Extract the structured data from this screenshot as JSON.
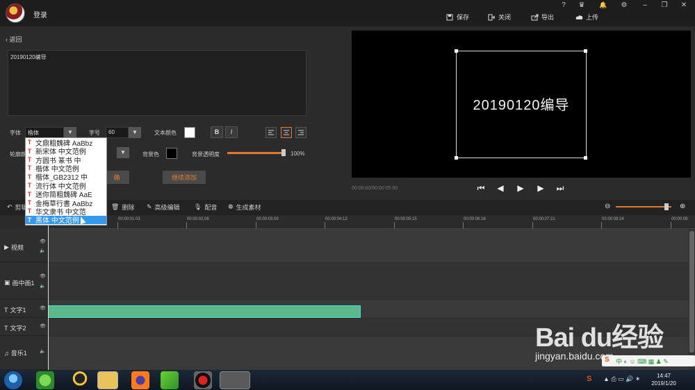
{
  "header": {
    "login_label": "登录",
    "actions": [
      {
        "label": "保存",
        "icon": "save-icon"
      },
      {
        "label": "关闭",
        "icon": "exit-icon"
      },
      {
        "label": "导出",
        "icon": "export-icon"
      },
      {
        "label": "上传",
        "icon": "upload-icon"
      }
    ],
    "window_controls": [
      "?",
      "♛",
      "🔔",
      "⚙",
      "–",
      "❐",
      "✕"
    ]
  },
  "editor": {
    "back_label": "返回",
    "text_value": "20190120编导",
    "font_label": "字体",
    "font_value": "楷体",
    "size_label": "字号",
    "size_value": "60",
    "text_color_label": "文本颜色",
    "bold_label": "B",
    "italic_label": "I",
    "outline_label": "轮廓颜",
    "bg_color_label": "背景色",
    "bg_opacity_label": "背景透明度",
    "bg_opacity_value": "100%",
    "bg_opacity_fraction": 1.0,
    "continue_button": "继续添加",
    "accent_color": "#e07a30"
  },
  "font_dropdown": {
    "items": [
      "文鼎粗魏碑 AaBbz",
      "新宋体  中文范例",
      "方圆书  篆书  中",
      "楷体  中文范例",
      "楷体_GB2312  中",
      "流行体 中文范例",
      "迷你简粗魏碑 AaE",
      "金梅草行書 AaBbz",
      "华文隶书 中文范",
      "黑体  中文范例"
    ],
    "selected_index": 9
  },
  "preview": {
    "overlay_text": "20190120编导",
    "timecode": "00:00:00/00:00:05:00"
  },
  "toolbar": {
    "items": [
      {
        "label": "剪辑",
        "icon": "undo-icon"
      },
      {
        "label": "删除",
        "icon": "trash-icon"
      },
      {
        "label": "高级编辑",
        "icon": "pen-icon"
      },
      {
        "label": "配音",
        "icon": "mic-icon"
      },
      {
        "label": "生成素材",
        "icon": "film-reel-icon"
      }
    ]
  },
  "timeline": {
    "ticks": [
      "00:00:01:03",
      "00:00:02:06",
      "00:00:03:09",
      "00:00:04:12",
      "00:00:05:15",
      "00:00:06:18",
      "00:00:07:21",
      "00:00:08:24",
      "00:00:09:"
    ],
    "tracks": [
      {
        "name": "视频",
        "icon": "video-icon"
      },
      {
        "name": "画中画1",
        "icon": "pip-icon"
      },
      {
        "name": "文字1",
        "icon": "text-icon"
      },
      {
        "name": "文字2",
        "icon": "text-icon"
      },
      {
        "name": "音乐1",
        "icon": "music-icon"
      }
    ]
  },
  "taskbar": {
    "time": "14:47",
    "date": "2019/1/20"
  },
  "watermark": {
    "brand": "Bai du经验",
    "url": "jingyan.baidu.com"
  }
}
